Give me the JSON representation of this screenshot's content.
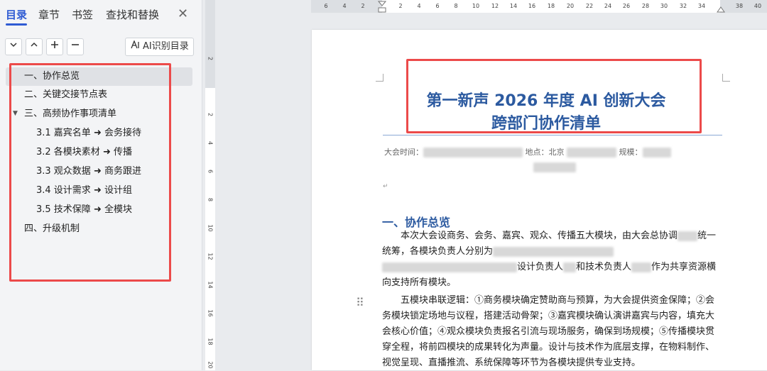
{
  "tabs": [
    {
      "label": "目录",
      "active": true
    },
    {
      "label": "章节"
    },
    {
      "label": "书签"
    },
    {
      "label": "查找和替换"
    }
  ],
  "close_label": "✕",
  "ai_button_label": "AI识别目录",
  "toc": [
    {
      "label": "一、协作总览",
      "level": 1,
      "active": true
    },
    {
      "label": "二、关键交接节点表",
      "level": 1
    },
    {
      "label": "三、高频协作事项清单",
      "level": 1,
      "expanded": true
    },
    {
      "label": "3.1 嘉宾名单 ➜ 会务接待",
      "level": 2
    },
    {
      "label": "3.2 各模块素材 ➜ 传播",
      "level": 2
    },
    {
      "label": "3.3 观众数据 ➜ 商务跟进",
      "level": 2
    },
    {
      "label": "3.4 设计需求 ➜ 设计组",
      "level": 2
    },
    {
      "label": "3.5 技术保障 ➜ 全模块",
      "level": 2
    },
    {
      "label": "四、升级机制",
      "level": 1
    }
  ],
  "ruler_h": [
    "6",
    "4",
    "2",
    "2",
    "4",
    "6",
    "8",
    "10",
    "12",
    "14",
    "16",
    "18",
    "20",
    "22",
    "24",
    "26",
    "28",
    "30",
    "32",
    "34",
    "38",
    "40"
  ],
  "ruler_v": [
    "2",
    "2",
    "4",
    "6",
    "8",
    "10",
    "12",
    "14",
    "16",
    "18",
    "20"
  ],
  "doc": {
    "title_line1": "第一新声 2026 年度 AI 创新大会",
    "title_line2": "跨部门协作清单",
    "meta_time": "大会时间：",
    "meta_place": "地点：北京",
    "meta_scale": "规模：",
    "section1_heading": "一、协作总览",
    "para1_a": "本次大会设商务、会务、嘉宾、观众、传播五大模块，由大会总协调",
    "para1_b": "统一统筹，各模块负责人分别为",
    "para1_c": "设计负责人",
    "para1_d": "和技术负责人",
    "para1_e": "作为共享资源横向支持所有模块。",
    "para2": "五模块串联逻辑：①商务模块确定赞助商与预算，为大会提供资金保障；②会务模块锁定场地与议程，搭建活动骨架；③嘉宾模块确认演讲嘉宾与内容，填充大会核心价值；④观众模块负责报名引流与现场服务，确保到场规模；⑤传播模块贯穿全程，将前四模块的成果转化为声量。设计与技术作为底层支撑，在物料制作、视觉呈现、直播推流、系统保障等环节为各模块提供专业支持。"
  },
  "colors": {
    "accent": "#2f5bd3",
    "heading": "#2c5aa0",
    "highlight_box": "#ec4a4a"
  },
  "icons": [
    "chevron-down-icon",
    "chevron-up-icon",
    "plus-icon",
    "minus-icon",
    "ai-icon",
    "close-icon",
    "collapse-triangle-icon",
    "drag-handle-icon"
  ]
}
